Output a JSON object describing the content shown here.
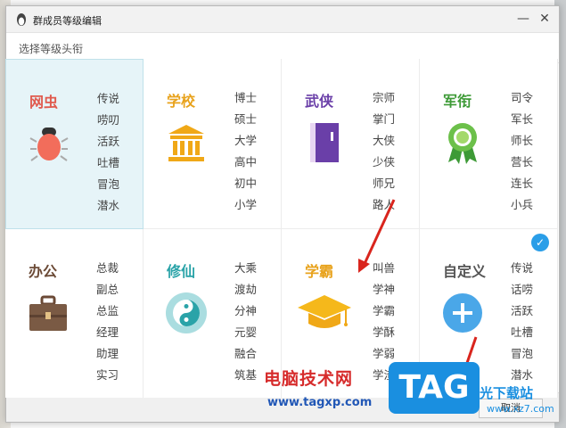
{
  "window": {
    "title": "群成员等级编辑",
    "minimize_glyph": "—",
    "close_glyph": "✕"
  },
  "subtitle": "选择等级头衔",
  "categories": [
    {
      "name": "网虫",
      "color": "#e05a4e",
      "icon": "bug-icon",
      "items": [
        "传说",
        "唠叨",
        "活跃",
        "吐槽",
        "冒泡",
        "潜水"
      ]
    },
    {
      "name": "学校",
      "color": "#e8a21b",
      "icon": "school-building-icon",
      "items": [
        "博士",
        "硕士",
        "大学",
        "高中",
        "初中",
        "小学"
      ]
    },
    {
      "name": "武侠",
      "color": "#6a3fa8",
      "icon": "book-icon",
      "items": [
        "宗师",
        "掌门",
        "大侠",
        "少侠",
        "师兄",
        "路人"
      ]
    },
    {
      "name": "军衔",
      "color": "#3d9a36",
      "icon": "medal-icon",
      "items": [
        "司令",
        "军长",
        "师长",
        "营长",
        "连长",
        "小兵"
      ]
    },
    {
      "name": "办公",
      "color": "#6b4a36",
      "icon": "briefcase-icon",
      "items": [
        "总裁",
        "副总",
        "总监",
        "经理",
        "助理",
        "实习"
      ]
    },
    {
      "name": "修仙",
      "color": "#2aa3a8",
      "icon": "yin-yang-icon",
      "items": [
        "大乘",
        "渡劫",
        "分神",
        "元婴",
        "融合",
        "筑基"
      ]
    },
    {
      "name": "学霸",
      "color": "#e8a21b",
      "icon": "graduation-cap-icon",
      "items": [
        "叫兽",
        "学神",
        "学霸",
        "学酥",
        "学弱",
        "学渣"
      ]
    },
    {
      "name": "自定义",
      "color": "#555555",
      "icon": "plus-circle-icon",
      "items": [
        "传说",
        "话唠",
        "活跃",
        "吐槽",
        "冒泡",
        "潜水"
      ]
    }
  ],
  "selected_index": 0,
  "checked_index": 7,
  "footer": {
    "cancel_label": "取消"
  },
  "watermark": {
    "site_cn": "电脑技术网",
    "site_url": "www.tagxp.com",
    "logo": "TAG",
    "side_cn": "光下载站",
    "side_url": "www.xz7.com"
  },
  "colors": {
    "accent": "#2a9ee8",
    "selected_bg": "#e6f4f8",
    "arrow": "#d9251d"
  }
}
